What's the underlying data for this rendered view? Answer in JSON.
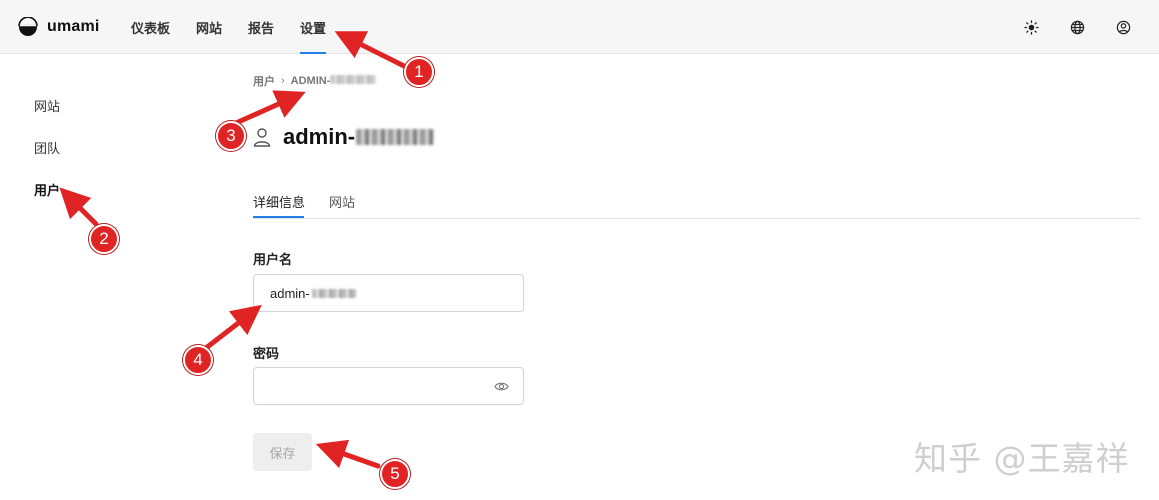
{
  "app": {
    "name": "umami"
  },
  "nav": {
    "items": [
      {
        "label": "仪表板"
      },
      {
        "label": "网站"
      },
      {
        "label": "报告"
      },
      {
        "label": "设置"
      }
    ],
    "active_index": 3
  },
  "top_icons": [
    "sun-icon",
    "globe-icon",
    "user-circle-icon"
  ],
  "sidebar": {
    "items": [
      {
        "label": "网站"
      },
      {
        "label": "团队"
      },
      {
        "label": "用户"
      }
    ],
    "active_index": 2
  },
  "breadcrumb": {
    "root": "用户",
    "current": "ADMIN-"
  },
  "page": {
    "title": "admin-"
  },
  "tabs": [
    {
      "label": "详细信息"
    },
    {
      "label": "网站"
    }
  ],
  "form": {
    "username_label": "用户名",
    "username_value": "admin-",
    "password_label": "密码",
    "password_value": "",
    "save_label": "保存"
  },
  "annotations": {
    "badges": [
      "1",
      "2",
      "3",
      "4",
      "5"
    ],
    "color": "#e02424"
  },
  "watermark": "知乎 @王嘉祥",
  "colors": {
    "accent": "#2680eb",
    "annotation": "#e02424"
  }
}
